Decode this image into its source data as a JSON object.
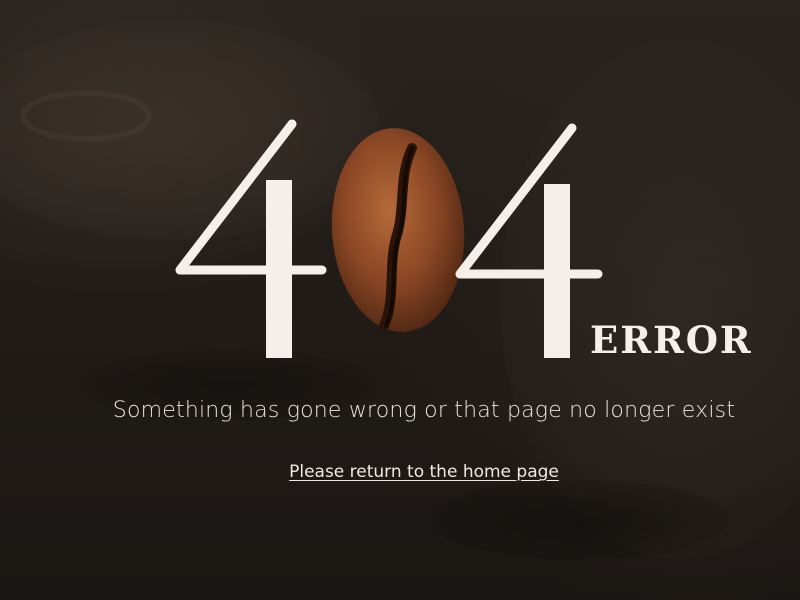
{
  "hero": {
    "code_left": "4",
    "code_right": "4",
    "label": "ERROR",
    "middle_icon": "coffee-bean-icon"
  },
  "message": "Something has gone wrong or that page no longer exist",
  "home_link": {
    "label": "Please return to the home page"
  },
  "colors": {
    "background": "#201b17",
    "text": "#f4efe9",
    "bean": "#8b4a26"
  }
}
